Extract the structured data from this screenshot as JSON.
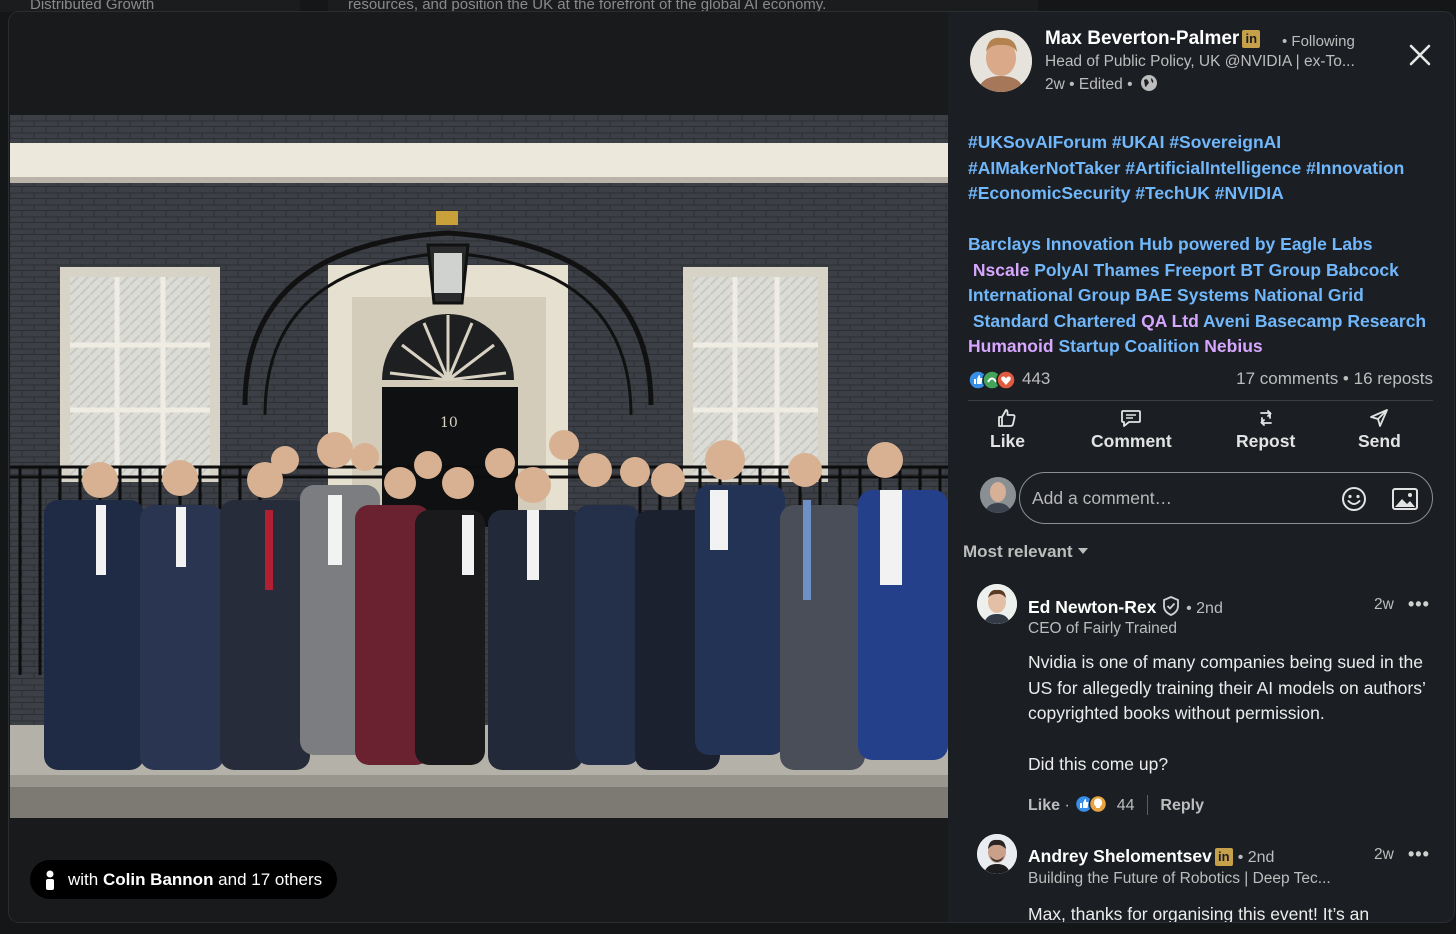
{
  "background": {
    "left_text": "Distributed Growth",
    "center_text": "resources, and position the UK at the forefront of the global AI economy."
  },
  "photo": {
    "door_number": "10",
    "with_prefix": "with ",
    "with_name": "Colin Bannon",
    "with_suffix": " and 17 others"
  },
  "author": {
    "name": "Max Beverton-Palmer",
    "badge": "in",
    "following": "• Following",
    "headline": "Head of Public Policy, UK @NVIDIA | ex-To...",
    "meta": "2w • Edited •"
  },
  "post": {
    "hashtags": [
      "#UKSovAIForum",
      "#UKAI",
      "#SovereignAI",
      "#AIMakerNotTaker",
      "#ArtificialIntelligence",
      "#Innovation",
      "#EconomicSecurity",
      "#TechUK",
      "#NVIDIA"
    ],
    "mentions": [
      {
        "text": "Barclays Innovation Hub powered by Eagle Labs",
        "kind": "company"
      },
      {
        "text": "Nscale",
        "kind": "person"
      },
      {
        "text": "PolyAI",
        "kind": "company"
      },
      {
        "text": "Thames Freeport",
        "kind": "company"
      },
      {
        "text": "BT Group",
        "kind": "company"
      },
      {
        "text": "Babcock International Group",
        "kind": "company"
      },
      {
        "text": "BAE Systems",
        "kind": "company"
      },
      {
        "text": "National Grid",
        "kind": "company"
      },
      {
        "text": "Standard Chartered",
        "kind": "company"
      },
      {
        "text": "QA Ltd",
        "kind": "person"
      },
      {
        "text": "Aveni",
        "kind": "company"
      },
      {
        "text": "Basecamp Research",
        "kind": "company"
      },
      {
        "text": "Humanoid",
        "kind": "person"
      },
      {
        "text": "Startup Coalition",
        "kind": "company"
      },
      {
        "text": "Nebius",
        "kind": "person"
      }
    ],
    "reaction_count": "443",
    "comments_reposts": "17 comments • 16 reposts"
  },
  "actions": {
    "like": "Like",
    "comment": "Comment",
    "repost": "Repost",
    "send": "Send"
  },
  "comment_box": {
    "placeholder": "Add a comment…"
  },
  "sort": {
    "label": "Most relevant"
  },
  "comments": [
    {
      "name": "Ed Newton-Rex",
      "degree": "• 2nd",
      "title": "CEO of Fairly Trained",
      "time": "2w",
      "more": "•••",
      "body_p1": "Nvidia is one of many companies being sued in the US for allegedly training their AI models on authors’ copyrighted books without permission.",
      "body_p2": "Did this come up?",
      "like": "Like",
      "reactions": "44",
      "reply": "Reply"
    },
    {
      "name": "Andrey Shelomentsev",
      "badge": "in",
      "degree": "• 2nd",
      "title": "Building the Future of Robotics | Deep Tec...",
      "time": "2w",
      "more": "•••",
      "body_p1": "Max, thanks for organising this event! It’s an"
    }
  ],
  "colors": {
    "link_blue": "#71b7fb",
    "link_purple": "#d7a6ff",
    "premium_gold": "#c7a04a",
    "panel_bg": "#1b1f23"
  }
}
